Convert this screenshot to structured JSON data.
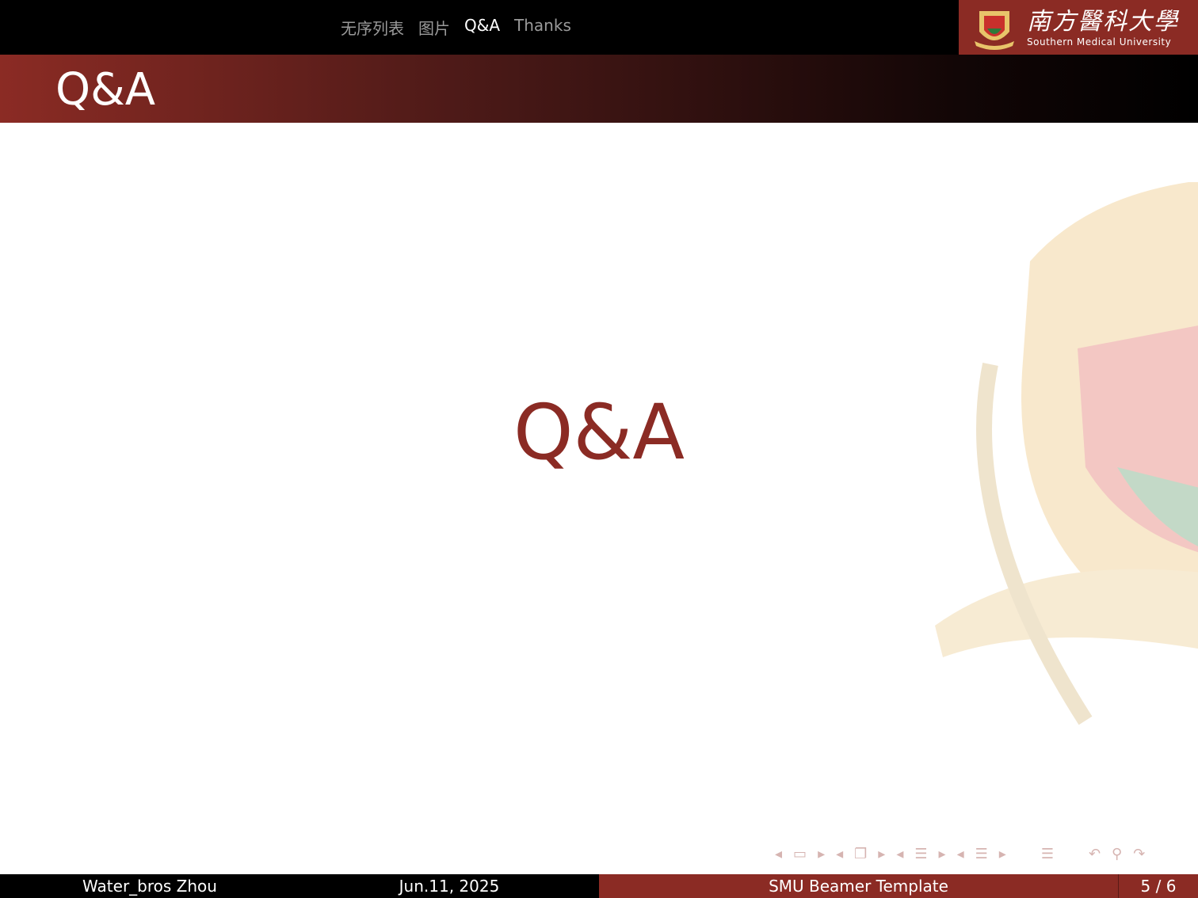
{
  "nav": {
    "items": [
      "无序列表",
      "图片",
      "Q&A",
      "Thanks"
    ],
    "active": 2
  },
  "logo": {
    "cn": "南方醫科大學",
    "en": "Southern Medical University"
  },
  "frame_title": "Q&A",
  "content": "Q&A",
  "footer": {
    "author": "Water_bros Zhou",
    "date": "Jun.11, 2025",
    "title": "SMU Beamer Template",
    "page": "5 / 6"
  },
  "colors": {
    "brand": "#8b2b24",
    "bar": "#000000"
  },
  "nav_symbols": [
    "slide-prev",
    "slide-icon",
    "slide-next",
    "frame-prev",
    "frame-icon",
    "frame-next",
    "subsection-prev",
    "subsection-icon",
    "subsection-next",
    "section-prev",
    "section-icon",
    "section-next",
    "toc-icon",
    "back-icon",
    "search-icon",
    "forward-icon"
  ]
}
